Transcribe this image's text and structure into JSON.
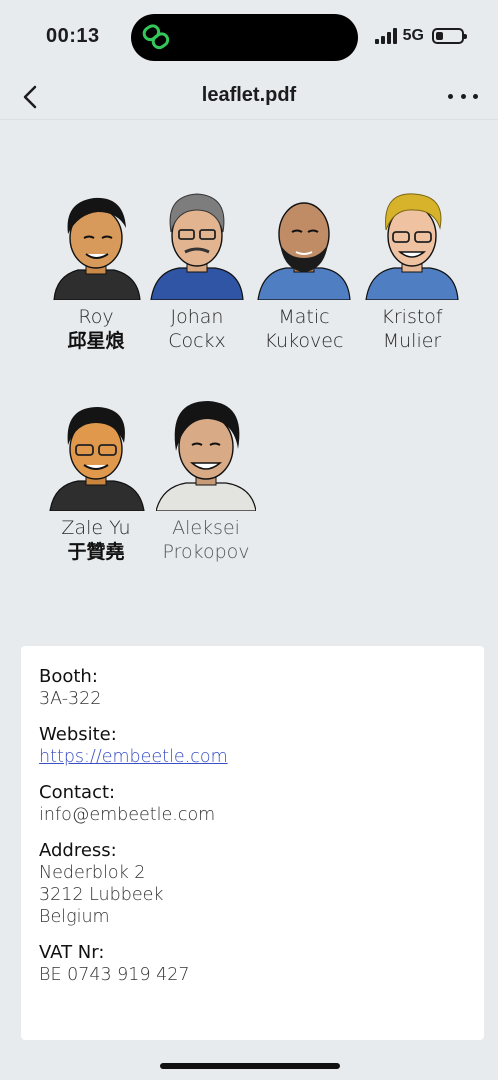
{
  "status": {
    "time": "00:13",
    "network": "5G",
    "battery_level": 0.3
  },
  "nav": {
    "title": "leaflet.pdf"
  },
  "people": [
    {
      "first": "Roy",
      "second": "邱星烺",
      "second_cjk": true,
      "icon": "avatar-roy-icon"
    },
    {
      "first": "Johan",
      "second": "Cockx",
      "second_cjk": false,
      "icon": "avatar-johan-icon"
    },
    {
      "first": "Matic",
      "second": "Kukovec",
      "second_cjk": false,
      "icon": "avatar-matic-icon"
    },
    {
      "first": "Kristof",
      "second": "Mulier",
      "second_cjk": false,
      "icon": "avatar-kristof-icon"
    },
    {
      "first": "Zale Yu",
      "second": "于贊堯",
      "second_cjk": true,
      "icon": "avatar-zale-icon"
    },
    {
      "first": "Aleksei",
      "second": "Prokopov",
      "second_cjk": false,
      "muted": true,
      "icon": "avatar-aleksei-icon"
    }
  ],
  "info": {
    "booth_label": "Booth:",
    "booth_value": "3A-322",
    "website_label": "Website:",
    "website_value": "https://embeetle.com",
    "contact_label": "Contact:",
    "contact_value": "info@embeetle.com",
    "address_label": "Address:",
    "address_line1": "Nederblok 2",
    "address_line2": "3212 Lubbeek",
    "address_line3": "Belgium",
    "vat_label": "VAT Nr:",
    "vat_value": "BE 0743 919 427"
  },
  "colors": {
    "link": "#3a4fc4",
    "island_icon": "#34c759"
  }
}
